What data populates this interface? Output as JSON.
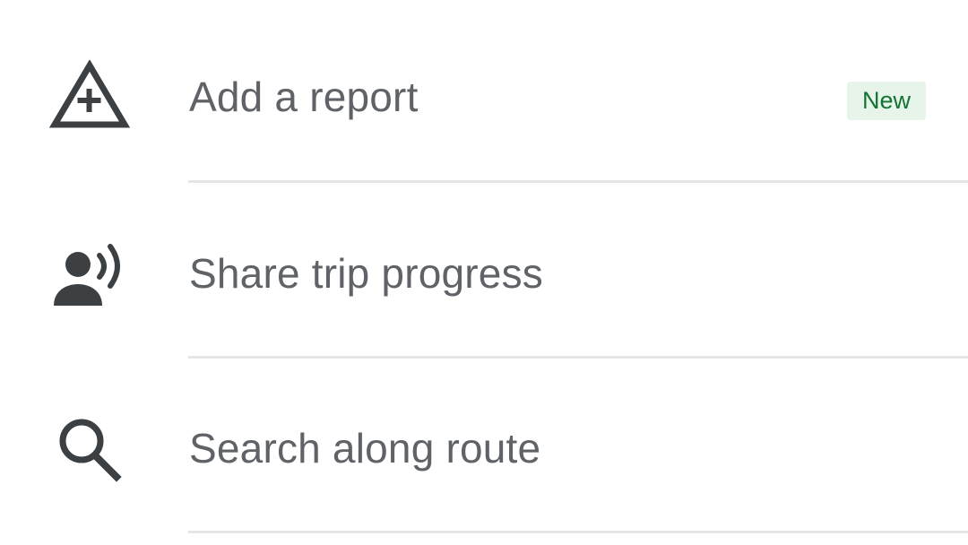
{
  "menu": {
    "items": [
      {
        "label": "Add a report",
        "icon": "add-report-warning-icon",
        "badge": "New"
      },
      {
        "label": "Share trip progress",
        "icon": "share-trip-person-broadcast-icon"
      },
      {
        "label": "Search along route",
        "icon": "search-icon"
      }
    ]
  },
  "colors": {
    "label_text": "#5f6368",
    "icon": "#3c4043",
    "divider": "#e6e6e6",
    "badge_bg": "#e6f4ea",
    "badge_text": "#137333"
  }
}
